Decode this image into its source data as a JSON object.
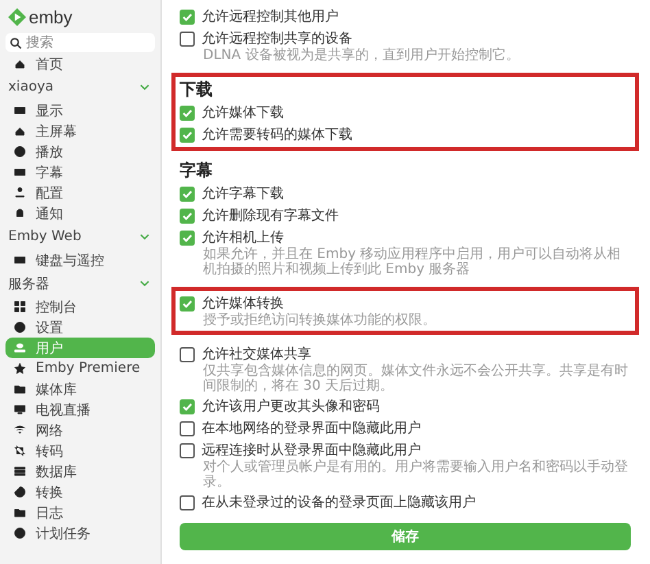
{
  "sidebar": {
    "logo": "emby",
    "search": {
      "placeholder": "搜索"
    },
    "groups": [
      {
        "items": [
          {
            "label": "首页",
            "selected": false
          }
        ]
      },
      {
        "title": "xiaoya",
        "expanded": true,
        "items": [
          {
            "label": "显示",
            "selected": false
          },
          {
            "label": "主屏幕",
            "selected": false
          },
          {
            "label": "播放",
            "selected": false
          },
          {
            "label": "字幕",
            "selected": false
          },
          {
            "label": "配置",
            "selected": false
          },
          {
            "label": "通知",
            "selected": false
          }
        ]
      },
      {
        "title": "Emby Web",
        "expanded": true,
        "items": [
          {
            "label": "键盘与遥控",
            "selected": false
          }
        ]
      },
      {
        "title": "服务器",
        "expanded": true,
        "items": [
          {
            "label": "控制台",
            "selected": false
          },
          {
            "label": "设置",
            "selected": false
          },
          {
            "label": "用户",
            "selected": true
          },
          {
            "label": "Emby Premiere",
            "selected": false
          },
          {
            "label": "媒体库",
            "selected": false
          },
          {
            "label": "电视直播",
            "selected": false
          },
          {
            "label": "网络",
            "selected": false
          },
          {
            "label": "转码",
            "selected": false
          },
          {
            "label": "数据库",
            "selected": false
          },
          {
            "label": "转换",
            "selected": false
          },
          {
            "label": "日志",
            "selected": false
          },
          {
            "label": "计划任务",
            "selected": false
          }
        ]
      }
    ]
  },
  "blocks": [
    {
      "highlighted": false,
      "items": [
        {
          "kind": "checkbox",
          "label": "允许远程控制其他用户",
          "checked": true
        },
        {
          "kind": "checkbox",
          "label": "允许远程控制共享的设备",
          "checked": false,
          "note": "DLNA 设备被视为是共享的，直到用户开始控制它。"
        }
      ]
    },
    {
      "highlighted": true,
      "items": [
        {
          "kind": "heading",
          "label": "下载"
        },
        {
          "kind": "checkbox",
          "label": "允许媒体下载",
          "checked": true
        },
        {
          "kind": "checkbox",
          "label": "允许需要转码的媒体下载",
          "checked": true
        }
      ]
    },
    {
      "highlighted": false,
      "items": [
        {
          "kind": "heading",
          "label": "字幕"
        },
        {
          "kind": "checkbox",
          "label": "允许字幕下载",
          "checked": true
        },
        {
          "kind": "checkbox",
          "label": "允许删除现有字幕文件",
          "checked": true
        },
        {
          "kind": "checkbox",
          "label": "允许相机上传",
          "checked": true,
          "note": "如果允许，并且在 Emby 移动应用程序中启用，用户可以自动将从相机拍摄的照片和视频上传到此 Emby 服务器"
        }
      ]
    },
    {
      "highlighted": true,
      "items": [
        {
          "kind": "checkbox",
          "label": "允许媒体转换",
          "checked": true,
          "note": "授予或拒绝访问转换媒体功能的权限。"
        }
      ]
    },
    {
      "highlighted": false,
      "items": [
        {
          "kind": "checkbox",
          "label": "允许社交媒体共享",
          "checked": false,
          "note": "仅共享包含媒体信息的网页。媒体文件永远不会公开共享。共享是有时间限制的，将在 30 天后过期。"
        },
        {
          "kind": "checkbox",
          "label": "允许该用户更改其头像和密码",
          "checked": true
        },
        {
          "kind": "checkbox",
          "label": "在本地网络的登录界面中隐藏此用户",
          "checked": false
        },
        {
          "kind": "checkbox",
          "label": "远程连接时从登录界面中隐藏此用户",
          "checked": false,
          "note": "对个人或管理员帐户是有用的。用户将需要输入用户名和密码以手动登录。"
        },
        {
          "kind": "checkbox",
          "label": "在从未登录过的设备的登录页面上隐藏该用户",
          "checked": false
        },
        {
          "kind": "button",
          "label": "储存"
        }
      ]
    }
  ]
}
